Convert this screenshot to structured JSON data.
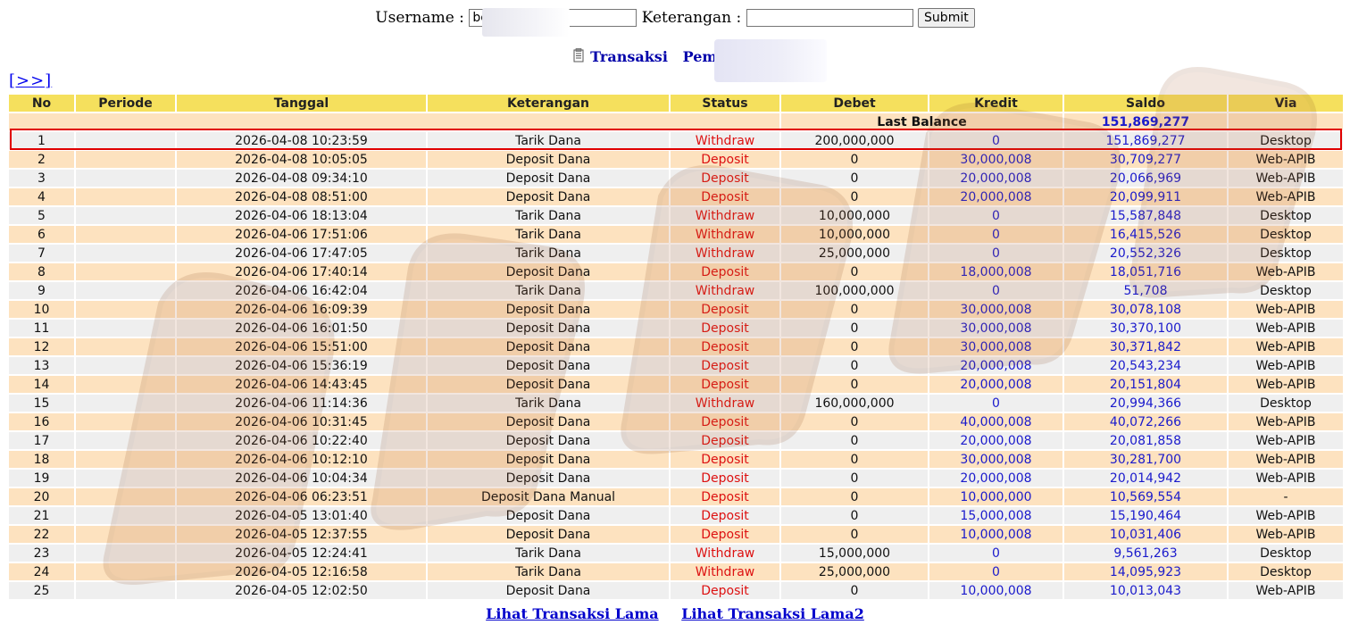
{
  "form": {
    "username_label": "Username :",
    "username_value": "be",
    "keterangan_label": "Keterangan :",
    "keterangan_value": "",
    "submit_label": "Submit"
  },
  "title": {
    "transaksi": "Transaksi",
    "pemain_label": "Pemain : be"
  },
  "nav": {
    "next_label": "[>>]"
  },
  "table": {
    "headers": [
      "No",
      "Periode",
      "Tanggal",
      "Keterangan",
      "Status",
      "Debet",
      "Kredit",
      "Saldo",
      "Via"
    ],
    "last_balance_label": "Last Balance",
    "last_balance_value": "151,869,277",
    "rows": [
      {
        "no": "1",
        "periode": "",
        "tanggal": "2026-04-08 10:23:59",
        "keterangan": "Tarik Dana",
        "status": "Withdraw",
        "debet": "200,000,000",
        "kredit": "0",
        "saldo": "151,869,277",
        "via": "Desktop"
      },
      {
        "no": "2",
        "periode": "",
        "tanggal": "2026-04-08 10:05:05",
        "keterangan": "Deposit Dana",
        "status": "Deposit",
        "debet": "0",
        "kredit": "30,000,008",
        "saldo": "30,709,277",
        "via": "Web-APIB"
      },
      {
        "no": "3",
        "periode": "",
        "tanggal": "2026-04-08 09:34:10",
        "keterangan": "Deposit Dana",
        "status": "Deposit",
        "debet": "0",
        "kredit": "20,000,008",
        "saldo": "20,066,969",
        "via": "Web-APIB"
      },
      {
        "no": "4",
        "periode": "",
        "tanggal": "2026-04-08 08:51:00",
        "keterangan": "Deposit Dana",
        "status": "Deposit",
        "debet": "0",
        "kredit": "20,000,008",
        "saldo": "20,099,911",
        "via": "Web-APIB"
      },
      {
        "no": "5",
        "periode": "",
        "tanggal": "2026-04-06 18:13:04",
        "keterangan": "Tarik Dana",
        "status": "Withdraw",
        "debet": "10,000,000",
        "kredit": "0",
        "saldo": "15,587,848",
        "via": "Desktop"
      },
      {
        "no": "6",
        "periode": "",
        "tanggal": "2026-04-06 17:51:06",
        "keterangan": "Tarik Dana",
        "status": "Withdraw",
        "debet": "10,000,000",
        "kredit": "0",
        "saldo": "16,415,526",
        "via": "Desktop"
      },
      {
        "no": "7",
        "periode": "",
        "tanggal": "2026-04-06 17:47:05",
        "keterangan": "Tarik Dana",
        "status": "Withdraw",
        "debet": "25,000,000",
        "kredit": "0",
        "saldo": "20,552,326",
        "via": "Desktop"
      },
      {
        "no": "8",
        "periode": "",
        "tanggal": "2026-04-06 17:40:14",
        "keterangan": "Deposit Dana",
        "status": "Deposit",
        "debet": "0",
        "kredit": "18,000,008",
        "saldo": "18,051,716",
        "via": "Web-APIB"
      },
      {
        "no": "9",
        "periode": "",
        "tanggal": "2026-04-06 16:42:04",
        "keterangan": "Tarik Dana",
        "status": "Withdraw",
        "debet": "100,000,000",
        "kredit": "0",
        "saldo": "51,708",
        "via": "Desktop"
      },
      {
        "no": "10",
        "periode": "",
        "tanggal": "2026-04-06 16:09:39",
        "keterangan": "Deposit Dana",
        "status": "Deposit",
        "debet": "0",
        "kredit": "30,000,008",
        "saldo": "30,078,108",
        "via": "Web-APIB"
      },
      {
        "no": "11",
        "periode": "",
        "tanggal": "2026-04-06 16:01:50",
        "keterangan": "Deposit Dana",
        "status": "Deposit",
        "debet": "0",
        "kredit": "30,000,008",
        "saldo": "30,370,100",
        "via": "Web-APIB"
      },
      {
        "no": "12",
        "periode": "",
        "tanggal": "2026-04-06 15:51:00",
        "keterangan": "Deposit Dana",
        "status": "Deposit",
        "debet": "0",
        "kredit": "30,000,008",
        "saldo": "30,371,842",
        "via": "Web-APIB"
      },
      {
        "no": "13",
        "periode": "",
        "tanggal": "2026-04-06 15:36:19",
        "keterangan": "Deposit Dana",
        "status": "Deposit",
        "debet": "0",
        "kredit": "20,000,008",
        "saldo": "20,543,234",
        "via": "Web-APIB"
      },
      {
        "no": "14",
        "periode": "",
        "tanggal": "2026-04-06 14:43:45",
        "keterangan": "Deposit Dana",
        "status": "Deposit",
        "debet": "0",
        "kredit": "20,000,008",
        "saldo": "20,151,804",
        "via": "Web-APIB"
      },
      {
        "no": "15",
        "periode": "",
        "tanggal": "2026-04-06 11:14:36",
        "keterangan": "Tarik Dana",
        "status": "Withdraw",
        "debet": "160,000,000",
        "kredit": "0",
        "saldo": "20,994,366",
        "via": "Desktop"
      },
      {
        "no": "16",
        "periode": "",
        "tanggal": "2026-04-06 10:31:45",
        "keterangan": "Deposit Dana",
        "status": "Deposit",
        "debet": "0",
        "kredit": "40,000,008",
        "saldo": "40,072,266",
        "via": "Web-APIB"
      },
      {
        "no": "17",
        "periode": "",
        "tanggal": "2026-04-06 10:22:40",
        "keterangan": "Deposit Dana",
        "status": "Deposit",
        "debet": "0",
        "kredit": "20,000,008",
        "saldo": "20,081,858",
        "via": "Web-APIB"
      },
      {
        "no": "18",
        "periode": "",
        "tanggal": "2026-04-06 10:12:10",
        "keterangan": "Deposit Dana",
        "status": "Deposit",
        "debet": "0",
        "kredit": "30,000,008",
        "saldo": "30,281,700",
        "via": "Web-APIB"
      },
      {
        "no": "19",
        "periode": "",
        "tanggal": "2026-04-06 10:04:34",
        "keterangan": "Deposit Dana",
        "status": "Deposit",
        "debet": "0",
        "kredit": "20,000,008",
        "saldo": "20,014,942",
        "via": "Web-APIB"
      },
      {
        "no": "20",
        "periode": "",
        "tanggal": "2026-04-06 06:23:51",
        "keterangan": "Deposit Dana Manual",
        "status": "Deposit",
        "debet": "0",
        "kredit": "10,000,000",
        "saldo": "10,569,554",
        "via": "-"
      },
      {
        "no": "21",
        "periode": "",
        "tanggal": "2026-04-05 13:01:40",
        "keterangan": "Deposit Dana",
        "status": "Deposit",
        "debet": "0",
        "kredit": "15,000,008",
        "saldo": "15,190,464",
        "via": "Web-APIB"
      },
      {
        "no": "22",
        "periode": "",
        "tanggal": "2026-04-05 12:37:55",
        "keterangan": "Deposit Dana",
        "status": "Deposit",
        "debet": "0",
        "kredit": "10,000,008",
        "saldo": "10,031,406",
        "via": "Web-APIB"
      },
      {
        "no": "23",
        "periode": "",
        "tanggal": "2026-04-05 12:24:41",
        "keterangan": "Tarik Dana",
        "status": "Withdraw",
        "debet": "15,000,000",
        "kredit": "0",
        "saldo": "9,561,263",
        "via": "Desktop"
      },
      {
        "no": "24",
        "periode": "",
        "tanggal": "2026-04-05 12:16:58",
        "keterangan": "Tarik Dana",
        "status": "Withdraw",
        "debet": "25,000,000",
        "kredit": "0",
        "saldo": "14,095,923",
        "via": "Desktop"
      },
      {
        "no": "25",
        "periode": "",
        "tanggal": "2026-04-05 12:02:50",
        "keterangan": "Deposit Dana",
        "status": "Deposit",
        "debet": "0",
        "kredit": "10,000,008",
        "saldo": "10,013,043",
        "via": "Web-APIB"
      }
    ]
  },
  "footer": {
    "link1": "Lihat Transaksi Lama",
    "link2": "Lihat Transaksi Lama2"
  },
  "colors": {
    "header_bg": "#f5e05d",
    "row_even_bg": "#fde2bf",
    "row_odd_bg": "#efefef",
    "status_red": "#dd1111",
    "amount_blue": "#1a1acc",
    "highlight_border": "#e00000"
  },
  "icons": {
    "title_icon": "document-list-icon"
  }
}
